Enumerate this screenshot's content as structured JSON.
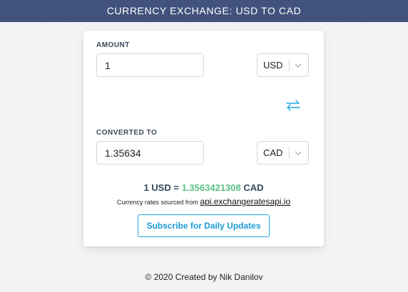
{
  "header": {
    "title": "CURRENCY EXCHANGE: USD TO CAD"
  },
  "amount": {
    "label": "AMOUNT",
    "value": "1",
    "currency": "USD"
  },
  "converted": {
    "label": "CONVERTED TO",
    "value": "1.35634",
    "currency": "CAD"
  },
  "rate": {
    "lhs": "1 USD =",
    "value": "1.3563421308",
    "unit": "CAD"
  },
  "source": {
    "text": "Currency rates sourced from",
    "link": "api.exchangeratesapi.io"
  },
  "subscribe": {
    "label": "Subscribe for Daily Updates"
  },
  "footer": {
    "text": "© 2020 Created by Nik Danilov"
  },
  "colors": {
    "header_bg": "#3d4f79",
    "accent": "#1fa8e0",
    "rate_value": "#5cc086"
  },
  "icons": [
    "chevron-down-icon",
    "swap-arrows-icon"
  ]
}
